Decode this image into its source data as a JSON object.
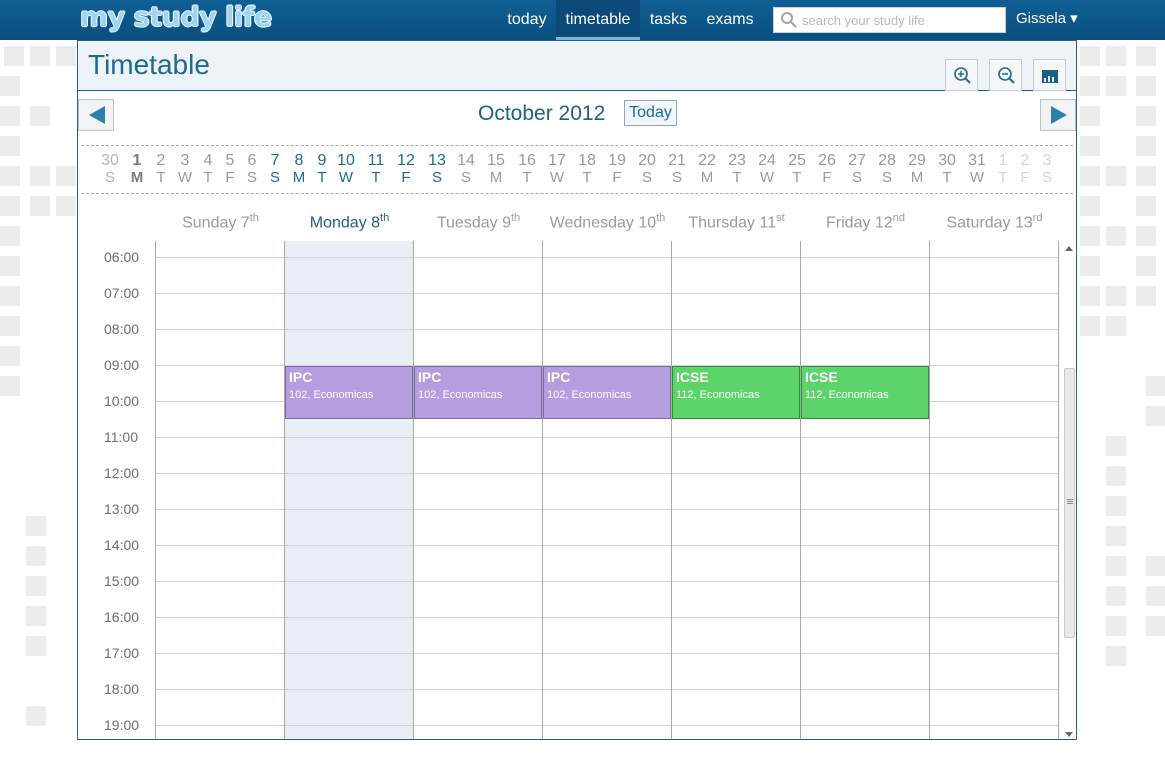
{
  "app": {
    "logo": "my study life"
  },
  "nav": [
    {
      "label": "today",
      "active": false
    },
    {
      "label": "timetable",
      "active": true
    },
    {
      "label": "tasks",
      "active": false
    },
    {
      "label": "exams",
      "active": false
    }
  ],
  "search": {
    "placeholder": "search your study life"
  },
  "user": {
    "name": "Gissela ▾"
  },
  "page": {
    "title": "Timetable"
  },
  "toolbar": {
    "zoom_in": "zoom-in-icon",
    "zoom_out": "zoom-out-icon",
    "export": "chart-icon"
  },
  "calendar": {
    "month_label": "October 2012",
    "today_label": "Today",
    "strip": [
      {
        "n": "30",
        "w": "S",
        "s": "dim"
      },
      {
        "n": "1",
        "w": "M",
        "s": "today"
      },
      {
        "n": "2",
        "w": "T",
        "s": "grey"
      },
      {
        "n": "3",
        "w": "W",
        "s": "grey"
      },
      {
        "n": "4",
        "w": "T",
        "s": "grey"
      },
      {
        "n": "5",
        "w": "F",
        "s": "grey"
      },
      {
        "n": "6",
        "w": "S",
        "s": "grey"
      },
      {
        "n": "7",
        "w": "S",
        "s": "week"
      },
      {
        "n": "8",
        "w": "M",
        "s": "week"
      },
      {
        "n": "9",
        "w": "T",
        "s": "week"
      },
      {
        "n": "10",
        "w": "W",
        "s": "week"
      },
      {
        "n": "11",
        "w": "T",
        "s": "week"
      },
      {
        "n": "12",
        "w": "F",
        "s": "week"
      },
      {
        "n": "13",
        "w": "S",
        "s": "week"
      },
      {
        "n": "14",
        "w": "S",
        "s": "grey"
      },
      {
        "n": "15",
        "w": "M",
        "s": "grey"
      },
      {
        "n": "16",
        "w": "T",
        "s": "grey"
      },
      {
        "n": "17",
        "w": "W",
        "s": "grey"
      },
      {
        "n": "18",
        "w": "T",
        "s": "grey"
      },
      {
        "n": "19",
        "w": "F",
        "s": "grey"
      },
      {
        "n": "20",
        "w": "S",
        "s": "grey"
      },
      {
        "n": "21",
        "w": "S",
        "s": "grey"
      },
      {
        "n": "22",
        "w": "M",
        "s": "grey"
      },
      {
        "n": "23",
        "w": "T",
        "s": "grey"
      },
      {
        "n": "24",
        "w": "W",
        "s": "grey"
      },
      {
        "n": "25",
        "w": "T",
        "s": "grey"
      },
      {
        "n": "26",
        "w": "F",
        "s": "grey"
      },
      {
        "n": "27",
        "w": "S",
        "s": "grey"
      },
      {
        "n": "28",
        "w": "S",
        "s": "grey"
      },
      {
        "n": "29",
        "w": "M",
        "s": "grey"
      },
      {
        "n": "30",
        "w": "T",
        "s": "grey"
      },
      {
        "n": "31",
        "w": "W",
        "s": "grey"
      },
      {
        "n": "1",
        "w": "T",
        "s": "faint"
      },
      {
        "n": "2",
        "w": "F",
        "s": "faint"
      },
      {
        "n": "3",
        "w": "S",
        "s": "faint"
      }
    ],
    "columns": [
      {
        "day": "Sunday 7",
        "suffix": "th",
        "current": false
      },
      {
        "day": "Monday 8",
        "suffix": "th",
        "current": true
      },
      {
        "day": "Tuesday 9",
        "suffix": "th",
        "current": false
      },
      {
        "day": "Wednesday 10",
        "suffix": "th",
        "current": false
      },
      {
        "day": "Thursday 11",
        "suffix": "st",
        "current": false
      },
      {
        "day": "Friday 12",
        "suffix": "nd",
        "current": false
      },
      {
        "day": "Saturday 13",
        "suffix": "rd",
        "current": false
      }
    ],
    "hours": [
      "06:00",
      "07:00",
      "08:00",
      "09:00",
      "10:00",
      "11:00",
      "12:00",
      "13:00",
      "14:00",
      "15:00",
      "16:00",
      "17:00",
      "18:00",
      "19:00"
    ],
    "events": [
      {
        "day": 1,
        "title": "IPC",
        "location": "102, Economicas",
        "color": "purple",
        "start": "09:00",
        "end": "10:30"
      },
      {
        "day": 2,
        "title": "IPC",
        "location": "102, Economicas",
        "color": "purple",
        "start": "09:00",
        "end": "10:30"
      },
      {
        "day": 3,
        "title": "IPC",
        "location": "102, Economicas",
        "color": "purple",
        "start": "09:00",
        "end": "10:30"
      },
      {
        "day": 4,
        "title": "ICSE",
        "location": "112, Economicas",
        "color": "green",
        "start": "09:00",
        "end": "10:30"
      },
      {
        "day": 5,
        "title": "ICSE",
        "location": "112, Economicas",
        "color": "green",
        "start": "09:00",
        "end": "10:30"
      }
    ]
  },
  "colors": {
    "header_blue": "#0f5f95",
    "accent": "#1e6a93",
    "event_purple": "#b39fdf",
    "event_green": "#5cd46a",
    "today_column": "#e8eef4"
  }
}
